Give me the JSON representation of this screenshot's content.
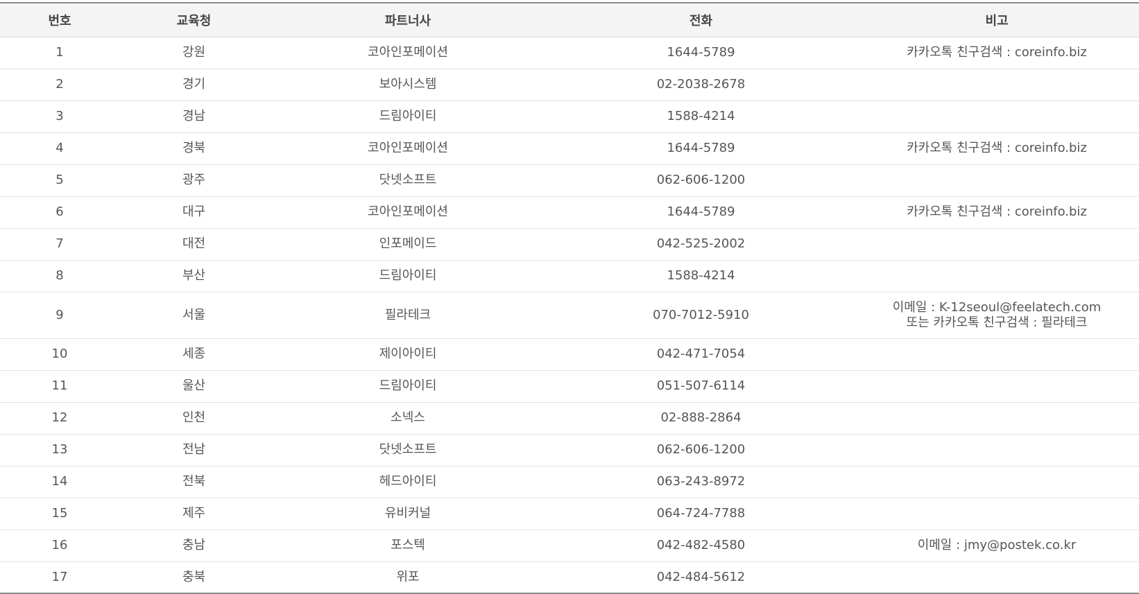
{
  "headers": [
    "번호",
    "교육청",
    "파트너사",
    "전화",
    "비고"
  ],
  "rows": [
    {
      "no": "1",
      "office": "강원",
      "partner": "코아인포메이션",
      "phone": "1644-5789",
      "note": [
        "카카오톡 친구검색 : coreinfo.biz"
      ]
    },
    {
      "no": "2",
      "office": "경기",
      "partner": "보아시스템",
      "phone": "02-2038-2678",
      "note": []
    },
    {
      "no": "3",
      "office": "경남",
      "partner": "드림아이티",
      "phone": "1588-4214",
      "note": []
    },
    {
      "no": "4",
      "office": "경북",
      "partner": "코아인포메이션",
      "phone": "1644-5789",
      "note": [
        "카카오톡 친구검색 : coreinfo.biz"
      ]
    },
    {
      "no": "5",
      "office": "광주",
      "partner": "닷넷소프트",
      "phone": "062-606-1200",
      "note": []
    },
    {
      "no": "6",
      "office": "대구",
      "partner": "코아인포메이션",
      "phone": "1644-5789",
      "note": [
        "카카오톡 친구검색 : coreinfo.biz"
      ]
    },
    {
      "no": "7",
      "office": "대전",
      "partner": "인포메이드",
      "phone": "042-525-2002",
      "note": []
    },
    {
      "no": "8",
      "office": "부산",
      "partner": "드림아이티",
      "phone": "1588-4214",
      "note": []
    },
    {
      "no": "9",
      "office": "서울",
      "partner": "필라테크",
      "phone": "070-7012-5910",
      "note": [
        "이메일 : K-12seoul@feelatech.com",
        "또는 카카오톡 친구검색 : 필라테크"
      ]
    },
    {
      "no": "10",
      "office": "세종",
      "partner": "제이아이티",
      "phone": "042-471-7054",
      "note": []
    },
    {
      "no": "11",
      "office": "울산",
      "partner": "드림아이티",
      "phone": "051-507-6114",
      "note": []
    },
    {
      "no": "12",
      "office": "인천",
      "partner": "소넥스",
      "phone": "02-888-2864",
      "note": []
    },
    {
      "no": "13",
      "office": "전남",
      "partner": "닷넷소프트",
      "phone": "062-606-1200",
      "note": []
    },
    {
      "no": "14",
      "office": "전북",
      "partner": "헤드아이티",
      "phone": "063-243-8972",
      "note": []
    },
    {
      "no": "15",
      "office": "제주",
      "partner": "유비커널",
      "phone": "064-724-7788",
      "note": []
    },
    {
      "no": "16",
      "office": "충남",
      "partner": "포스텍",
      "phone": "042-482-4580",
      "note": [
        "이메일 : jmy@postek.co.kr"
      ]
    },
    {
      "no": "17",
      "office": "충북",
      "partner": "위포",
      "phone": "042-484-5612",
      "note": []
    }
  ]
}
